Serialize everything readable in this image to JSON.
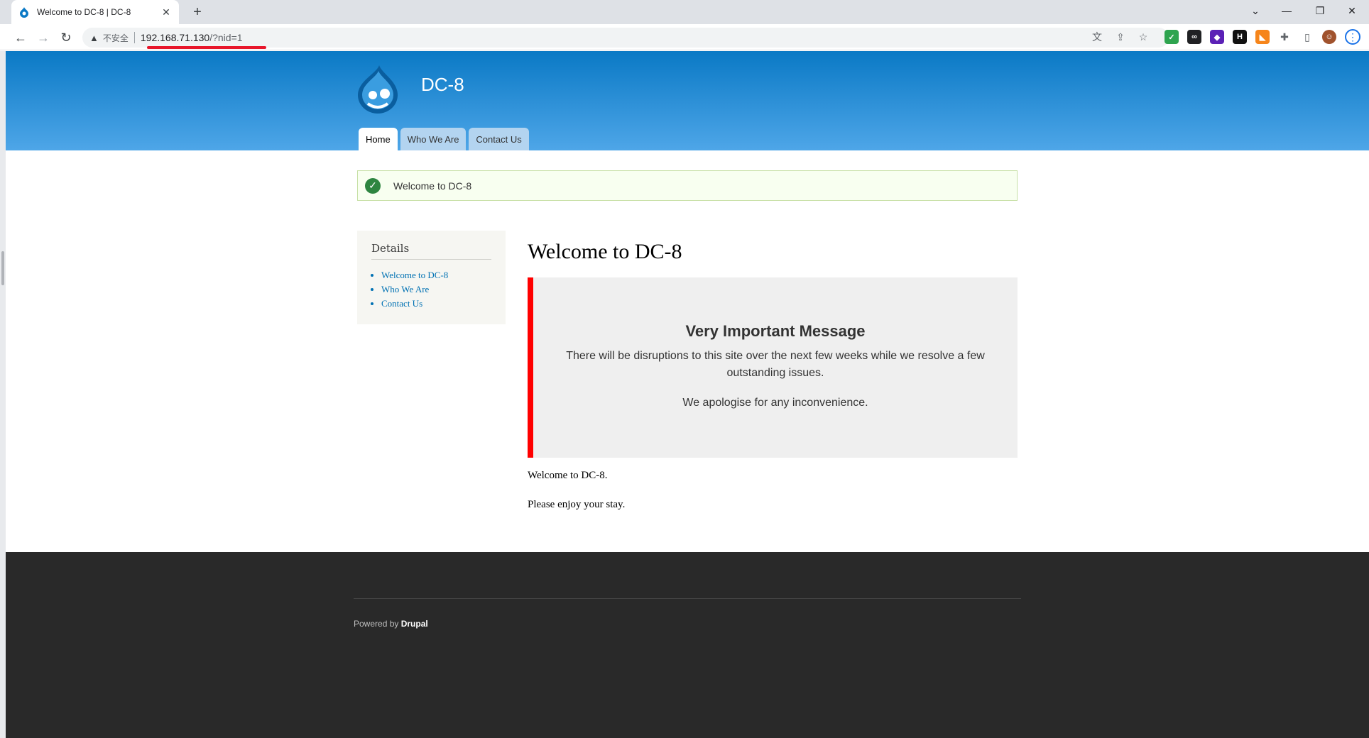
{
  "browser": {
    "tab_title": "Welcome to DC-8 | DC-8",
    "security_label": "不安全",
    "url_host": "192.168.71.130",
    "url_path": "/?nid=1"
  },
  "site": {
    "name": "DC-8",
    "nav": [
      "Home",
      "Who We Are",
      "Contact Us"
    ]
  },
  "status_message": "Welcome to DC-8",
  "sidebar": {
    "title": "Details",
    "links": [
      "Welcome to DC-8",
      "Who We Are",
      "Contact Us"
    ]
  },
  "main": {
    "title": "Welcome to DC-8",
    "notice_title": "Very Important Message",
    "notice_p1": "There will be disruptions to this site over the next few weeks while we resolve a few outstanding issues.",
    "notice_p2": "We apologise for any inconvenience.",
    "body_p1": "Welcome to DC-8.",
    "body_p2": "Please enjoy your stay."
  },
  "footer": {
    "powered_prefix": "Powered by ",
    "powered_link": "Drupal"
  },
  "colors": {
    "header_top": "#0a79c5",
    "header_bottom": "#4ea6e8",
    "notice_border": "#ff0000",
    "link": "#0071b3",
    "footer_bg": "#292929"
  }
}
